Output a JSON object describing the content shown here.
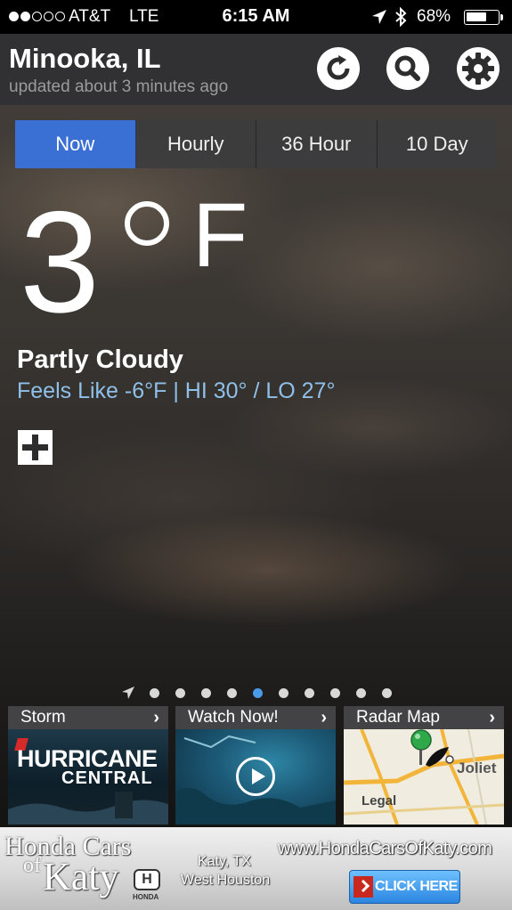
{
  "status_bar": {
    "carrier": "AT&T",
    "network": "LTE",
    "time": "6:15 AM",
    "battery_percent": "68%",
    "battery_level": 0.68,
    "signal_bars_filled": 2,
    "signal_bars_total": 5,
    "icons": [
      "location-arrow-icon",
      "bluetooth-icon",
      "battery-icon"
    ]
  },
  "header": {
    "city": "Minooka, IL",
    "updated": "updated about 3 minutes ago",
    "buttons": [
      "refresh-icon",
      "search-icon",
      "gear-icon"
    ]
  },
  "tabs": [
    {
      "label": "Now",
      "active": true
    },
    {
      "label": "Hourly",
      "active": false
    },
    {
      "label": "36 Hour",
      "active": false
    },
    {
      "label": "10 Day",
      "active": false
    }
  ],
  "current": {
    "temperature": "3",
    "unit": "F",
    "condition": "Partly Cloudy",
    "details": "Feels Like -6°F | HI 30° / LO 27°"
  },
  "pager": {
    "total_dots": 10,
    "active_index": 4
  },
  "tiles": [
    {
      "label": "Storm",
      "line1": "HURRICANE",
      "line2": "CENTRAL"
    },
    {
      "label": "Watch Now!"
    },
    {
      "label": "Radar Map",
      "map_city": "Joliet",
      "legal": "Legal"
    }
  ],
  "ad": {
    "brand_line1": "Honda Cars",
    "brand_of": "of",
    "brand_line2": "Katy",
    "logo_letter": "H",
    "logo_word": "HONDA",
    "location1": "Katy, TX",
    "location2": "West Houston",
    "url": "www.HondaCarsOfKaty.com",
    "cta": "CLICK HERE"
  },
  "colors": {
    "accent": "#3a6fd4",
    "feels_like": "#8fc0ea",
    "pager_active": "#4a9ae8"
  }
}
